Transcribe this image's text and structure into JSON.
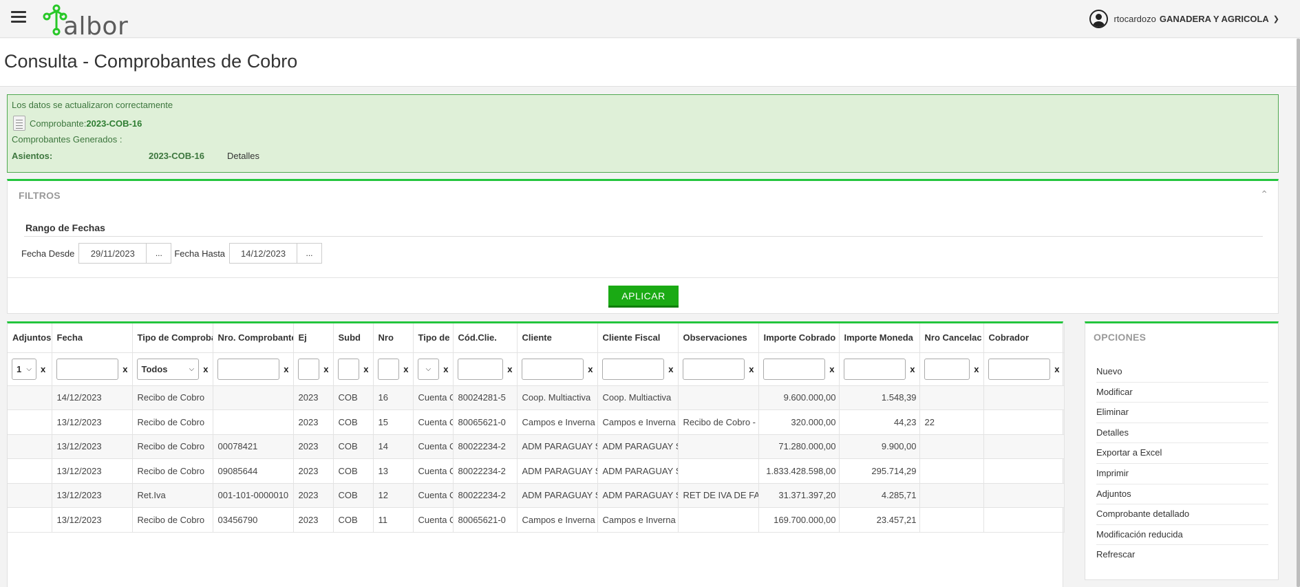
{
  "app": {
    "logo_text": "albor",
    "user": "rtocardozo",
    "company": "GANADERA Y AGRICOLA",
    "accent": "#23c53d"
  },
  "page": {
    "title": "Consulta - Comprobantes de Cobro"
  },
  "message": {
    "line1": "Los datos se actualizaron correctamente",
    "comprobante_label": "Comprobante:",
    "comprobante_value": "2023-COB-16",
    "generados": "Comprobantes Generados :",
    "asientos_label": "Asientos:",
    "asientos_value": "2023-COB-16",
    "detalles_link": "Detalles"
  },
  "filters": {
    "title": "FILTROS",
    "group_title": "Rango de Fechas",
    "desde_label": "Fecha Desde",
    "desde_value": "29/11/2023",
    "hasta_label": "Fecha Hasta",
    "hasta_value": "14/12/2023",
    "picker_label": "...",
    "apply_label": "APLICAR"
  },
  "grid": {
    "columns": [
      "Adjuntos",
      "Fecha",
      "Tipo de Comprobante",
      "Nro. Comprobante",
      "Ej",
      "Subd",
      "Nro",
      "Tipo de",
      "Cód.Clie.",
      "Cliente",
      "Cliente Fiscal",
      "Observaciones",
      "Importe Cobrado",
      "Importe Moneda",
      "Nro Cancelac",
      "Cobrador"
    ],
    "filter_adjuntos": "1",
    "filter_tipo": "Todos",
    "clear": "x",
    "rows": [
      [
        "",
        "14/12/2023",
        "Recibo de Cobro",
        "",
        "2023",
        "COB",
        "16",
        "Cuenta C",
        "80024281-5",
        "Coop. Multiactiva",
        "Coop. Multiactiva",
        "",
        "9.600.000,00",
        "1.548,39",
        "",
        ""
      ],
      [
        "",
        "13/12/2023",
        "Recibo de Cobro",
        "",
        "2023",
        "COB",
        "15",
        "Cuenta C",
        "80065621-0",
        "Campos e Inverna",
        "Campos e Inverna",
        "Recibo de Cobro -",
        "320.000,00",
        "44,23",
        "22",
        ""
      ],
      [
        "",
        "13/12/2023",
        "Recibo de Cobro",
        "00078421",
        "2023",
        "COB",
        "14",
        "Cuenta C",
        "80022234-2",
        "ADM PARAGUAY S",
        "ADM PARAGUAY S",
        "",
        "71.280.000,00",
        "9.900,00",
        "",
        ""
      ],
      [
        "",
        "13/12/2023",
        "Recibo de Cobro",
        "09085644",
        "2023",
        "COB",
        "13",
        "Cuenta C",
        "80022234-2",
        "ADM PARAGUAY S",
        "ADM PARAGUAY S",
        "",
        "1.833.428.598,00",
        "295.714,29",
        "",
        ""
      ],
      [
        "",
        "13/12/2023",
        "Ret.Iva",
        "001-101-0000010",
        "2023",
        "COB",
        "12",
        "Cuenta C",
        "80022234-2",
        "ADM PARAGUAY S",
        "ADM PARAGUAY S",
        "RET DE IVA DE FAC",
        "31.371.397,20",
        "4.285,71",
        "",
        ""
      ],
      [
        "",
        "13/12/2023",
        "Recibo de Cobro",
        "03456790",
        "2023",
        "COB",
        "11",
        "Cuenta C",
        "80065621-0",
        "Campos e Inverna",
        "Campos e Inverna",
        "",
        "169.700.000,00",
        "23.457,21",
        "",
        ""
      ]
    ]
  },
  "options": {
    "title": "OPCIONES",
    "items": [
      "Nuevo",
      "Modificar",
      "Eliminar",
      "Detalles",
      "Exportar a Excel",
      "Imprimir",
      "Adjuntos",
      "Comprobante detallado",
      "Modificación reducida",
      "Refrescar"
    ]
  }
}
